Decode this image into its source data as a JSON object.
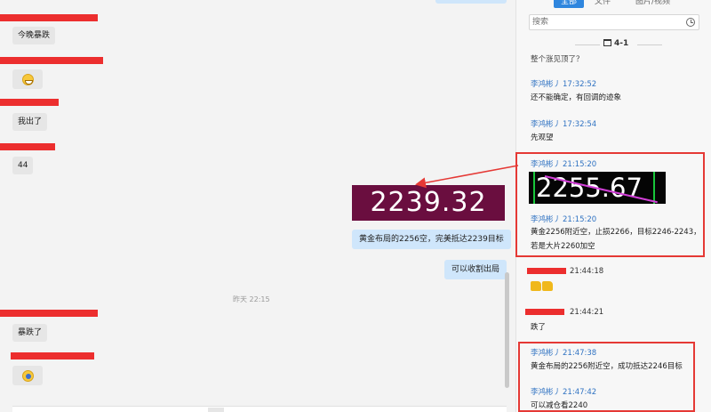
{
  "chat": {
    "messages_in": [
      "今晚暴跌",
      "我出了",
      "44",
      "暴跌了"
    ],
    "price_image_value": "2239.32",
    "messages_out": [
      "黄金布局的2256空，完美抵达2239目标",
      "可以收割出局"
    ],
    "timestamp": "昨天 22:15"
  },
  "history": {
    "tabs": [
      "全部",
      "文件",
      "图片/视频"
    ],
    "active_tab": 0,
    "search_placeholder": "搜索",
    "date_label": "4-1",
    "partial_top": "整个涨见顶了？",
    "entries": [
      {
        "sender": "李鸿彬丿",
        "time": "17:32:52",
        "text": "还不能确定，有回调的迹象"
      },
      {
        "sender": "李鸿彬丿",
        "time": "17:32:54",
        "text": "先观望"
      },
      {
        "sender": "李鸿彬丿",
        "time": "21:15:20",
        "image_value": "2255.67"
      },
      {
        "sender": "李鸿彬丿",
        "time": "21:15:20",
        "text": "黄金2256附近空，止损2266，目标2246-2243，若是大片2260加空"
      },
      {
        "time": "21:44:18"
      },
      {
        "time": "21:44:21",
        "text": "跌了"
      },
      {
        "sender": "李鸿彬丿",
        "time": "21:47:38",
        "text": "黄金布局的2256附近空，成功抵达2246目标"
      },
      {
        "sender": "李鸿彬丿",
        "time": "21:47:42",
        "text": "可以减仓看2240"
      }
    ]
  },
  "colors": {
    "accent": "#2f86de",
    "redact": "#ec2e2e",
    "highlight": "#e53935",
    "bubble_out": "#cfe6fb",
    "price_bg": "#6a0e3f"
  }
}
